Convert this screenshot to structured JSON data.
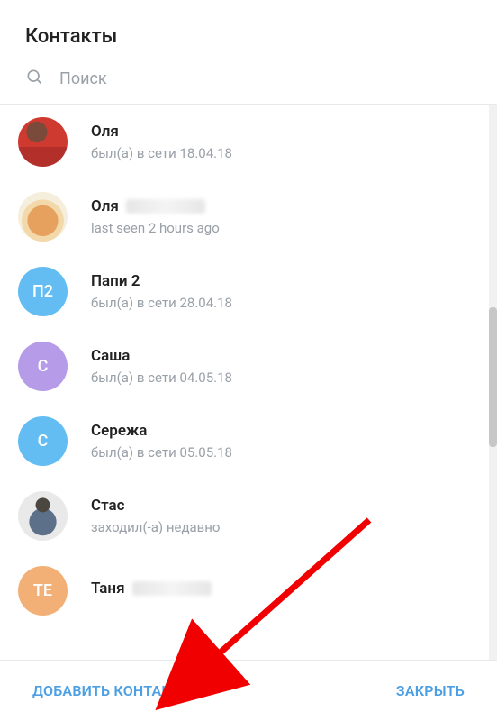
{
  "header": {
    "title": "Контакты"
  },
  "search": {
    "placeholder": "Поиск"
  },
  "contacts": [
    {
      "name": "Оля",
      "status": "был(а) в сети 18.04.18",
      "avatar": {
        "type": "photo",
        "key": "0"
      }
    },
    {
      "name": "Оля",
      "status": "last seen 2 hours ago",
      "name_blurred": true,
      "avatar": {
        "type": "photo",
        "key": "1"
      }
    },
    {
      "name": "Папи 2",
      "status": "был(а) в сети 28.04.18",
      "avatar": {
        "type": "initials",
        "text": "П2",
        "bg": "#63bdf2"
      }
    },
    {
      "name": "Саша",
      "status": "был(а) в сети 04.05.18",
      "avatar": {
        "type": "initials",
        "text": "С",
        "bg": "#b59be8"
      }
    },
    {
      "name": "Сережа",
      "status": "был(а) в сети 05.05.18",
      "avatar": {
        "type": "initials",
        "text": "С",
        "bg": "#63bdf2"
      }
    },
    {
      "name": "Стас",
      "status": "заходил(-а) недавно",
      "avatar": {
        "type": "photo",
        "key": "5"
      }
    },
    {
      "name": "Таня",
      "status": "",
      "name_blurred": true,
      "avatar": {
        "type": "initials",
        "text": "ТЕ",
        "bg": "#f2b077"
      }
    }
  ],
  "footer": {
    "add": "ДОБАВИТЬ КОНТАКТ",
    "close": "ЗАКРЫТЬ"
  },
  "colors": {
    "accent": "#4d9fe3",
    "muted": "#9aa0a8",
    "arrow": "#f00000"
  }
}
